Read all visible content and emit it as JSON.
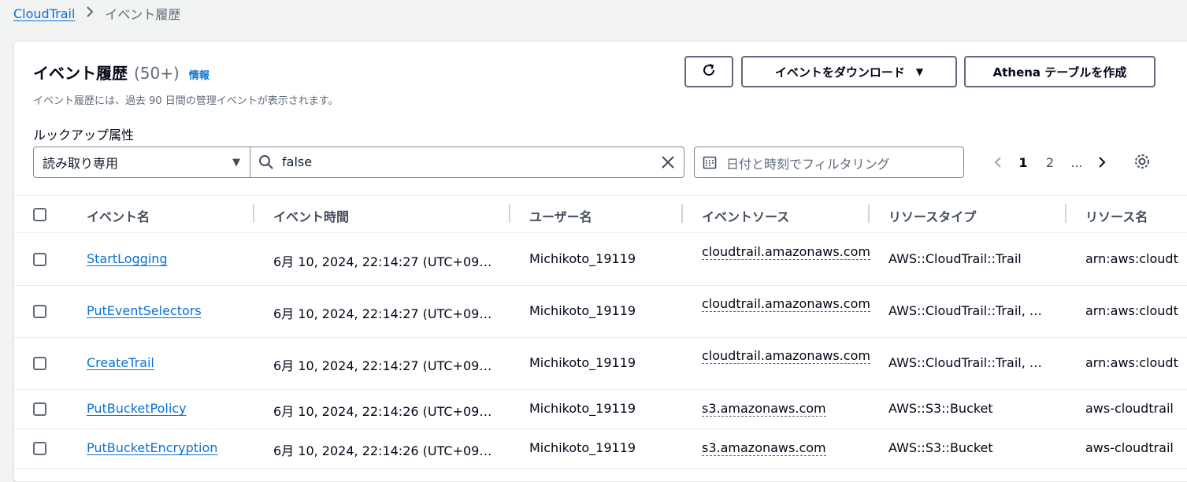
{
  "breadcrumb": {
    "root": "CloudTrail",
    "current": "イベント履歴"
  },
  "header": {
    "title": "イベント履歴",
    "count": "(50+)",
    "info": "情報",
    "description": "イベント履歴には、過去 90 日間の管理イベントが表示されます。"
  },
  "toolbar": {
    "refresh_icon": "refresh-icon",
    "download_label": "イベントをダウンロード",
    "athena_label": "Athena テーブルを作成"
  },
  "filter": {
    "lookup_label": "ルックアップ属性",
    "attribute_selected": "読み取り専用",
    "search_value": "false",
    "date_placeholder": "日付と時刻でフィルタリング"
  },
  "pagination": {
    "pages": [
      "1",
      "2",
      "..."
    ],
    "current": "1"
  },
  "table": {
    "columns": [
      "イベント名",
      "イベント時間",
      "ユーザー名",
      "イベントソース",
      "リソースタイプ",
      "リソース名"
    ],
    "rows": [
      {
        "name": "StartLogging",
        "time": "6月 10, 2024, 22:14:27 (UTC+09…",
        "user": "Michikoto_19119",
        "source": "cloudtrail.amazonaws.com",
        "type": "AWS::CloudTrail::Trail",
        "resource": "arn:aws:cloudt"
      },
      {
        "name": "PutEventSelectors",
        "time": "6月 10, 2024, 22:14:27 (UTC+09…",
        "user": "Michikoto_19119",
        "source": "cloudtrail.amazonaws.com",
        "type": "AWS::CloudTrail::Trail, …",
        "resource": "arn:aws:cloudt"
      },
      {
        "name": "CreateTrail",
        "time": "6月 10, 2024, 22:14:27 (UTC+09…",
        "user": "Michikoto_19119",
        "source": "cloudtrail.amazonaws.com",
        "type": "AWS::CloudTrail::Trail, …",
        "resource": "arn:aws:cloudt"
      },
      {
        "name": "PutBucketPolicy",
        "time": "6月 10, 2024, 22:14:26 (UTC+09…",
        "user": "Michikoto_19119",
        "source": "s3.amazonaws.com",
        "type": "AWS::S3::Bucket",
        "resource": "aws-cloudtrail"
      },
      {
        "name": "PutBucketEncryption",
        "time": "6月 10, 2024, 22:14:26 (UTC+09…",
        "user": "Michikoto_19119",
        "source": "s3.amazonaws.com",
        "type": "AWS::S3::Bucket",
        "resource": "aws-cloudtrail"
      }
    ]
  },
  "colors": {
    "link": "#0972d3",
    "text": "#000716",
    "muted": "#5f6b7a"
  }
}
